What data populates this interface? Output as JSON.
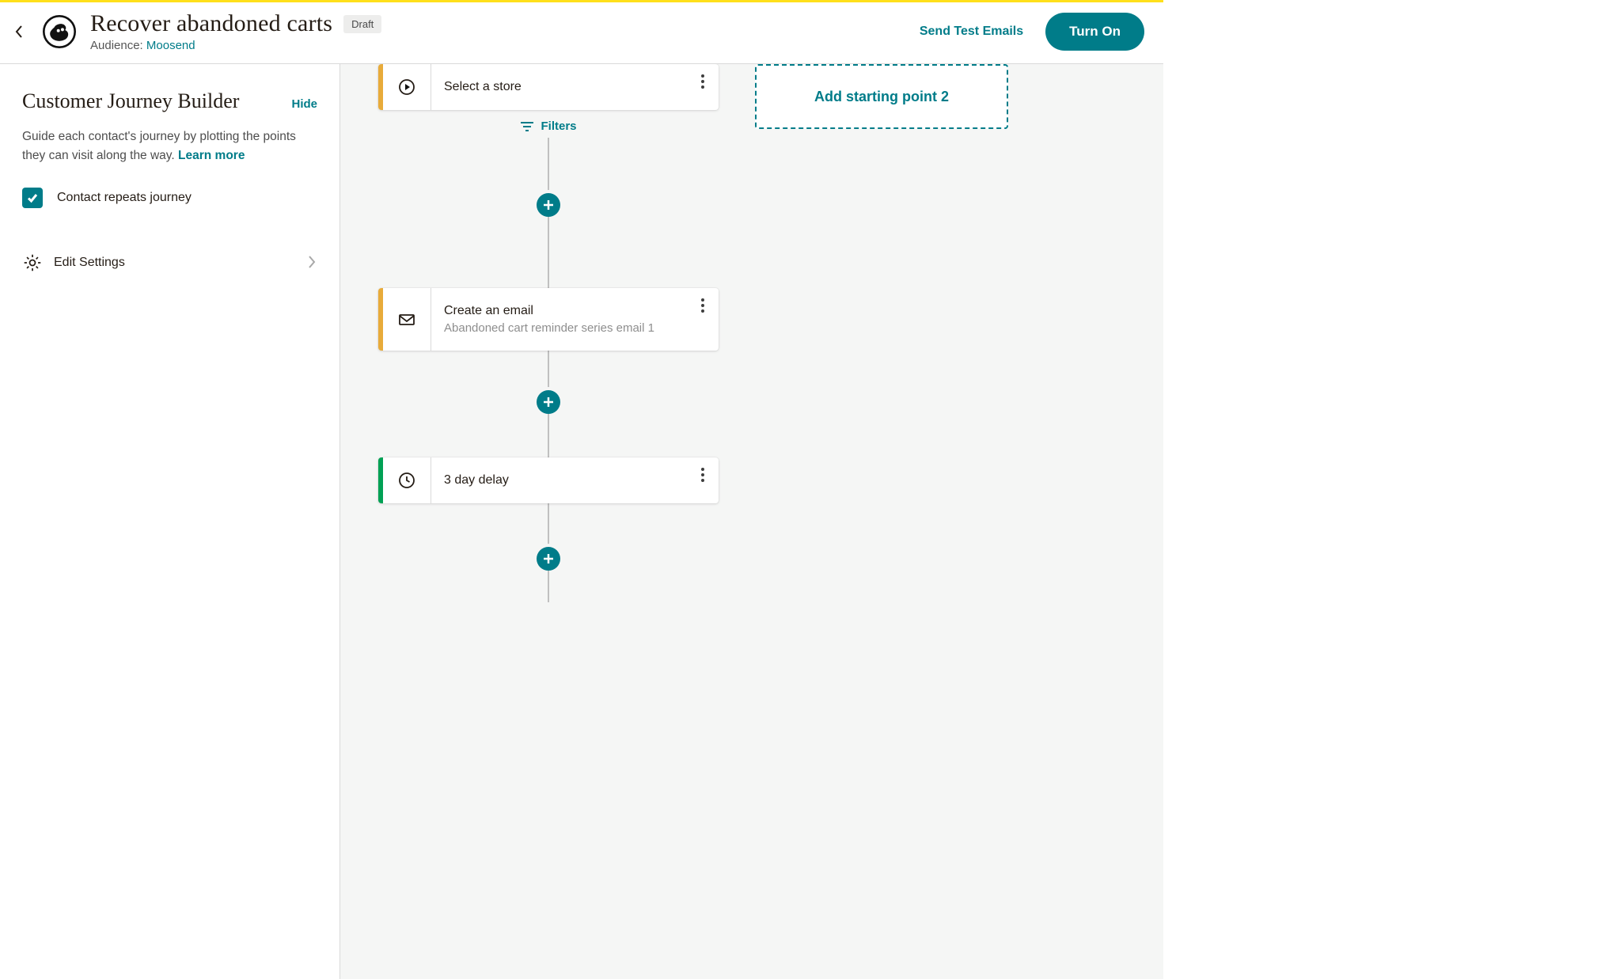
{
  "header": {
    "title": "Recover abandoned carts",
    "status_chip": "Draft",
    "audience_label": "Audience: ",
    "audience_name": "Moosend",
    "send_test": "Send Test Emails",
    "turn_on": "Turn On"
  },
  "sidebar": {
    "title": "Customer Journey Builder",
    "hide": "Hide",
    "description": "Guide each contact's journey by plotting the points they can visit along the way. ",
    "learn_more": "Learn more",
    "checkbox_label": "Contact repeats journey",
    "checkbox_checked": true,
    "settings_label": "Edit Settings"
  },
  "canvas": {
    "filters_label": "Filters",
    "add_starting_point_label": "Add starting point 2",
    "nodes": [
      {
        "accent": "amber",
        "icon": "play",
        "title": "Select a store",
        "subtitle": ""
      },
      {
        "accent": "amber",
        "icon": "mail",
        "title": "Create an email",
        "subtitle": "Abandoned cart reminder series email 1"
      },
      {
        "accent": "green",
        "icon": "clock",
        "title": "3 day delay",
        "subtitle": ""
      }
    ]
  }
}
